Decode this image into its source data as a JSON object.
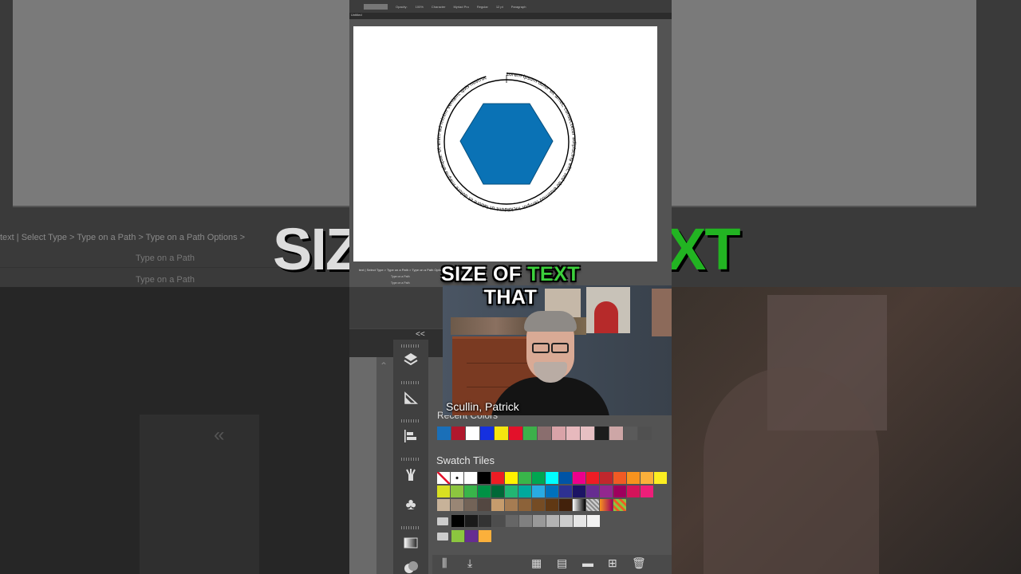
{
  "background": {
    "breadcrumb": "text  |  Select Type  >  Type on a Path  >  Type on a Path Options  >",
    "rows": [
      "Type on a Path",
      "Type on a Path"
    ],
    "big_text_left": "SIZ",
    "big_text_right": "XT"
  },
  "control_bar": {
    "items": [
      "Opacity:",
      "100%",
      "Character",
      "Myriad Pro",
      "Regular",
      "12 pt",
      "Paragraph"
    ]
  },
  "document_tab": "Untitled",
  "artwork": {
    "shape_color": "#0a72b5",
    "path_text": "Lorem ipsum dolor sit amet, consectetur adipiscing elit, sed do eiusmod tempor incididunt ut labore et dolore magna aliqua. Ut enim ad minim veniam, quis nostrud exercitation"
  },
  "panel_breadcrumb": "text  |  Select Type  >  Type on a Path  >  Type on a Path Options  >",
  "panel_rows": [
    "Type on a Path",
    "Type on a Path"
  ],
  "collapse_label": "<<",
  "webcam": {
    "name": "Scullin, Patrick"
  },
  "swatches": {
    "recent_title": "Recent Colors",
    "recent": [
      "#1a6fb8",
      "#b0182d",
      "#ffffff",
      "#1530e0",
      "#f5e60f",
      "#e3112a",
      "#3cb04a",
      "#8a6e6e",
      "#d9a3a8",
      "#e7b9bd",
      "#e7c0c3",
      "#1c1c1c",
      "#cda6a6",
      "#5a5a5a",
      "#505050"
    ],
    "title": "Swatch Tiles",
    "row1": [
      "none",
      "reg",
      "#ffffff",
      "#000000",
      "#ed1c24",
      "#fff200",
      "#39b54a",
      "#00a651",
      "#00ffff",
      "#0054a6",
      "#ec008c",
      "#ed1c24",
      "#c1272d",
      "#f15a24",
      "#f7931e",
      "#fbb03b",
      "#fcee21"
    ],
    "row2": [
      "#d9e021",
      "#8cc63f",
      "#39b54a",
      "#009245",
      "#006837",
      "#22b573",
      "#00a99d",
      "#29abe2",
      "#0071bc",
      "#2e3192",
      "#1b1464",
      "#662d91",
      "#93278f",
      "#9e005d",
      "#d4145a",
      "#ed1e79"
    ],
    "row3": [
      "#c7b299",
      "#998675",
      "#736357",
      "#534741",
      "#c69c6d",
      "#a67c52",
      "#8c6239",
      "#754c24",
      "#603813",
      "#42210b",
      "grad1",
      "grad2",
      "grad3",
      "grad4"
    ],
    "row4": [
      "#000000",
      "#1a1a1a",
      "#333333",
      "#4d4d4d",
      "#666666",
      "#808080",
      "#999999",
      "#b3b3b3",
      "#cccccc",
      "#e6e6e6",
      "#f2f2f2"
    ],
    "row5": [
      "#8cc63f",
      "#662d91",
      "#fbb03b"
    ]
  },
  "captions": {
    "line1_white": "SIZE OF",
    "line1_green": "TEXT",
    "line2": "THAT"
  }
}
